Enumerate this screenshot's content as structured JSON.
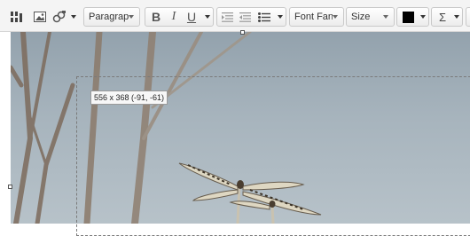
{
  "toolbar": {
    "paragraph_select": {
      "value": "Paragrap"
    },
    "font_family_select": {
      "value": "Font Fan"
    },
    "font_size_select": {
      "value": "Size"
    },
    "text_color": "#000000",
    "format": {
      "bold": "B",
      "italic": "I",
      "underline": "U"
    },
    "sigma": "Σ"
  },
  "image": {
    "dimensions_tooltip": "556 x 368 (-91, -61)"
  }
}
